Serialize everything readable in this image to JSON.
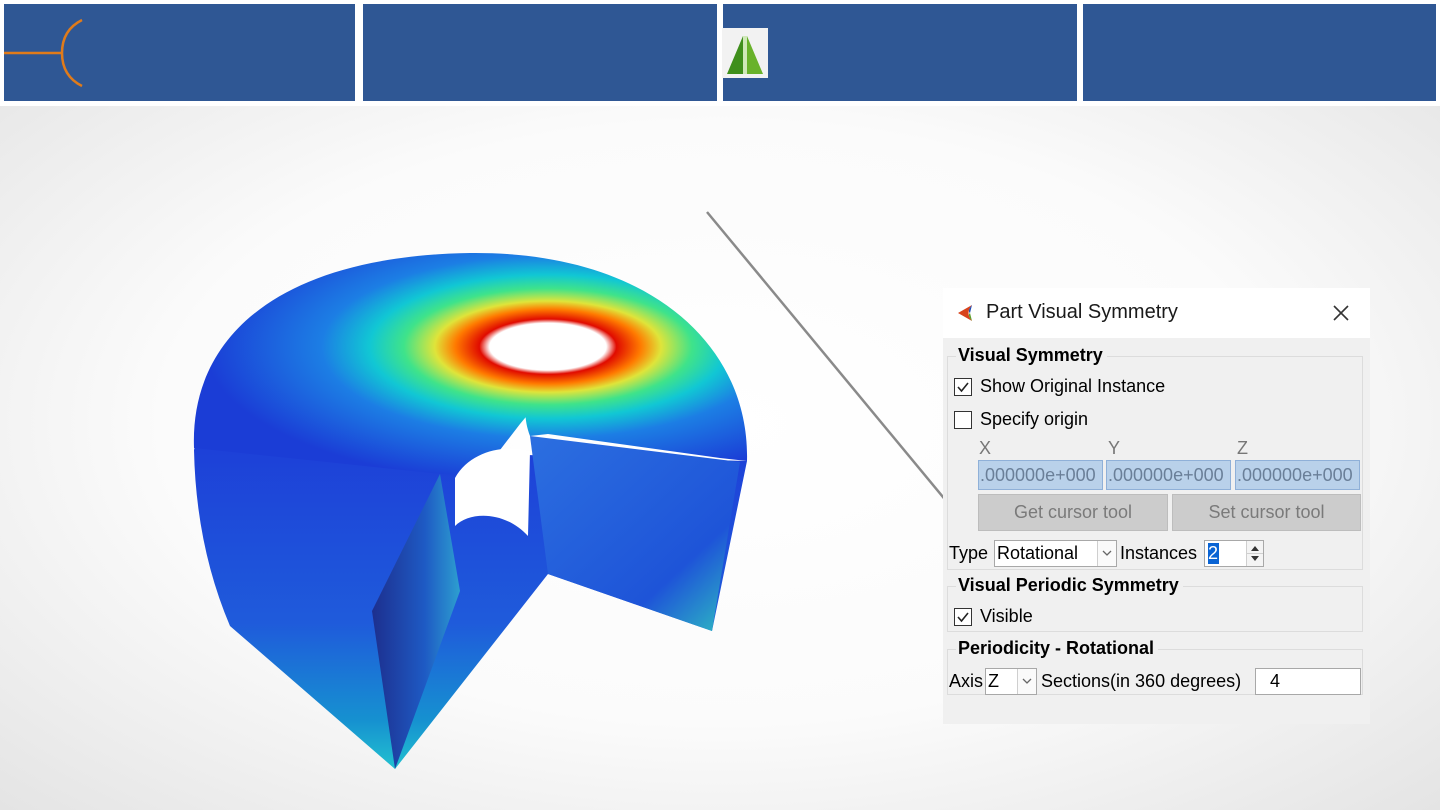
{
  "dialog": {
    "title": "Part Visual Symmetry",
    "visual_symmetry": {
      "heading": "Visual Symmetry",
      "show_original_instance": {
        "label": "Show Original Instance",
        "checked": true
      },
      "specify_origin": {
        "label": "Specify origin",
        "checked": false
      },
      "coords": {
        "x_label": "X",
        "y_label": "Y",
        "z_label": "Z",
        "x_value": ".000000e+000",
        "y_value": ".000000e+000",
        "z_value": ".000000e+000"
      },
      "get_cursor_label": "Get cursor tool",
      "set_cursor_label": "Set cursor tool",
      "type_label": "Type",
      "type_value": "Rotational",
      "instances_label": "Instances",
      "instances_value": "2"
    },
    "visual_periodic_symmetry": {
      "heading": "Visual Periodic Symmetry",
      "visible": {
        "label": "Visible",
        "checked": true
      }
    },
    "periodicity": {
      "heading": "Periodicity - Rotational",
      "axis_label": "Axis",
      "axis_value": "Z",
      "sections_label": "Sections(in 360 degrees)",
      "sections_value": "4"
    }
  },
  "colors": {
    "header_blue": "#2f5794",
    "bracket_orange": "#e07b1a",
    "contour_low": "#1c3fd6",
    "contour_high": "#d81c0c"
  },
  "icons": [
    "bracket-icon",
    "app-logo-icon",
    "app-icon",
    "close-icon",
    "checkmark-icon",
    "chevron-down-icon",
    "spin-arrows-icon"
  ]
}
